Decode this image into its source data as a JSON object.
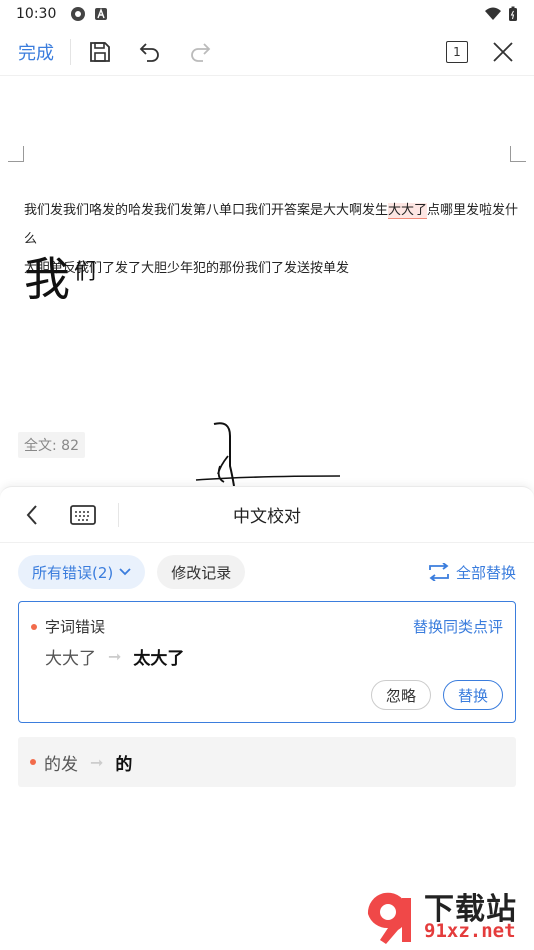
{
  "status_bar": {
    "time": "10:30"
  },
  "toolbar": {
    "done_label": "完成",
    "page_number": "1"
  },
  "document": {
    "line1_before": "我们发我们咯发的哈发我们发第八单口我们开答案是大大啊发生",
    "line1_error": "大大了",
    "line1_after": "点哪里发啦发什么",
    "line2": "大胆单反我们了发了大胆少年犯的那份我们了发送按单发",
    "big_char": "我",
    "sup_char": "们",
    "word_count": "全文: 82"
  },
  "panel": {
    "title": "中文校对",
    "filter_all": "所有错误(2)",
    "filter_history": "修改记录",
    "replace_all": "全部替换",
    "card1": {
      "type": "字词错误",
      "replace_same": "替换同类点评",
      "original": "大大了",
      "suggestion": "太大了",
      "ignore": "忽略",
      "replace": "替换"
    },
    "card2": {
      "original": "的发",
      "suggestion": "的"
    }
  },
  "watermark": {
    "brand": "下载站",
    "domain": "91xz.net"
  },
  "colors": {
    "accent": "#3b7ddd",
    "error_dot": "#f26b4b"
  }
}
